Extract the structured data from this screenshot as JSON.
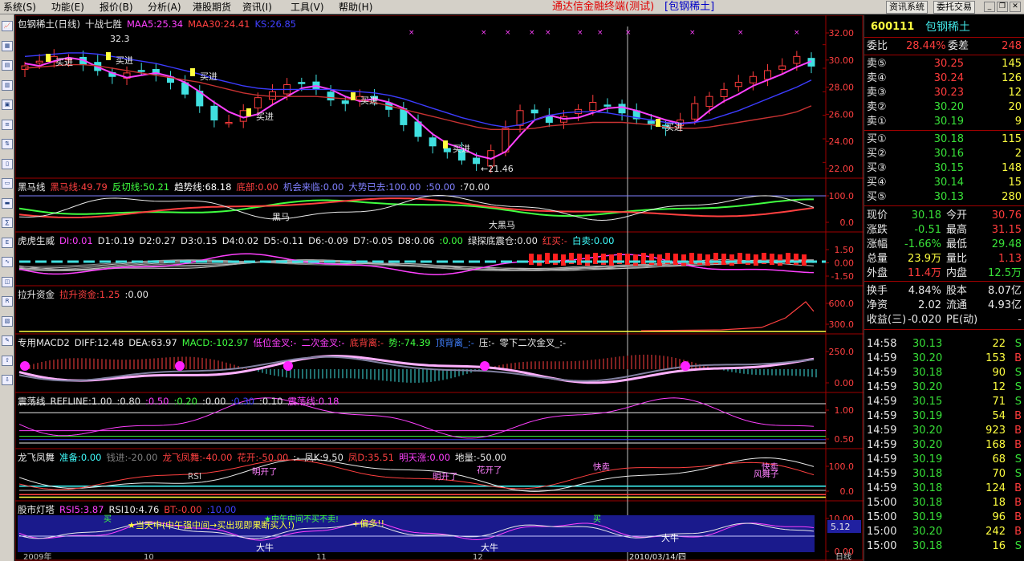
{
  "menu": {
    "items": [
      "系统(S)",
      "功能(E)",
      "报价(B)",
      "分析(A)",
      "港股期货",
      "资讯(I)",
      "工具(V)",
      "帮助(H)"
    ],
    "app_title": "通达信金融终端(测试)",
    "ticker_title": "[包钢稀土]",
    "btn_info": "资讯系统",
    "btn_trade": "委托交易"
  },
  "colors": {
    "up": "#ff3c3c",
    "down": "#38e038",
    "flat": "#e8e8e8",
    "accent": "#ffff40",
    "grid": "#a00000"
  },
  "toolbar_icons": [
    "chart-icon",
    "grid-icon",
    "table-icon",
    "bar-icon",
    "window-icon",
    "list-icon",
    "sort-icon",
    "doc-icon",
    "folder-icon",
    "news-icon",
    "calc-icon",
    "etf-icon",
    "wave-icon",
    "indicator-icon",
    "rsi-icon",
    "layout-icon",
    "edit-icon",
    "up-arrow-icon",
    "down-arrow-icon"
  ],
  "panes": [
    {
      "id": "main",
      "labels": [
        [
          "包钢稀土(日线)",
          "#e8e8e8"
        ],
        [
          "十战七胜",
          "#e8e8e8"
        ],
        [
          "MAA5:25.34",
          "#ff40ff"
        ],
        [
          "MAA30:24.41",
          "#ff4040"
        ],
        [
          "KS:26.85",
          "#4040ff"
        ]
      ],
      "axis": [
        "32.00",
        "30.00",
        "28.00",
        "26.00",
        "24.00",
        "22.00"
      ],
      "annotations": [
        "32.30",
        "买进",
        "买进",
        "买进",
        "买进",
        "买进",
        "买进",
        "买进",
        "←21.46"
      ]
    },
    {
      "id": "heima",
      "labels": [
        [
          "黑马线",
          "#e8e8e8"
        ],
        [
          "黑马线:49.79",
          "#ff4040"
        ],
        [
          "反切线:50.21",
          "#40ff40"
        ],
        [
          "趋势线:68.18",
          "#ffffff"
        ],
        [
          "底部:0.00",
          "#ff4040"
        ],
        [
          "机会来临:0.00",
          "#8080ff"
        ],
        [
          "大势已去:100.00",
          "#8080ff"
        ],
        [
          ":50.00",
          "#8080ff"
        ],
        [
          ":70.00",
          "#e8e8e8"
        ]
      ],
      "axis": [
        "100.0",
        "0.0"
      ],
      "annotations": [
        "黑马",
        "大黑马"
      ]
    },
    {
      "id": "huhu",
      "labels": [
        [
          "虎虎生威",
          "#e8e8e8"
        ],
        [
          "DI:0.01",
          "#ff40ff"
        ],
        [
          "D1:0.19",
          "#e8e8e8"
        ],
        [
          "D2:0.27",
          "#e8e8e8"
        ],
        [
          "D3:0.15",
          "#e8e8e8"
        ],
        [
          "D4:0.02",
          "#e8e8e8"
        ],
        [
          "D5:-0.11",
          "#e8e8e8"
        ],
        [
          "D6:-0.09",
          "#e8e8e8"
        ],
        [
          "D7:-0.05",
          "#e8e8e8"
        ],
        [
          "D8:0.06",
          "#e8e8e8"
        ],
        [
          ":0.00",
          "#40ff40"
        ],
        [
          "绿探底震仓:0.00",
          "#e8e8e8"
        ],
        [
          "红买:-",
          "#ff4040"
        ],
        [
          "白卖:0.00",
          "#40ffff"
        ]
      ],
      "axis": [
        "1.50",
        "0.00",
        "-1.50"
      ]
    },
    {
      "id": "lasheng",
      "labels": [
        [
          "拉升资金",
          "#e8e8e8"
        ],
        [
          "拉升资金:1.25",
          "#ff4040"
        ],
        [
          ":0.00",
          "#e8e8e8"
        ]
      ],
      "axis": [
        "600.0",
        "300.0"
      ]
    },
    {
      "id": "macd",
      "labels": [
        [
          "专用MACD2",
          "#e8e8e8"
        ],
        [
          "DIFF:12.48",
          "#e8e8e8"
        ],
        [
          "DEA:63.97",
          "#e8e8e8"
        ],
        [
          "MACD:-102.97",
          "#40ff40"
        ],
        [
          "低位金叉:-",
          "#ff40ff"
        ],
        [
          "二次金叉:-",
          "#ff40ff"
        ],
        [
          "底背离:-",
          "#ff4040"
        ],
        [
          "势:-74.39",
          "#40ff40"
        ],
        [
          "顶背离_:-",
          "#4080ff"
        ],
        [
          "压:-",
          "#e8e8e8"
        ],
        [
          "零下二次金叉_:-",
          "#e8e8e8"
        ]
      ],
      "axis": [
        "250.0",
        "0.00"
      ]
    },
    {
      "id": "zhendang",
      "labels": [
        [
          "震荡线",
          "#e8e8e8"
        ],
        [
          "REFLINE:1.00",
          "#e8e8e8"
        ],
        [
          ":0.80",
          "#e8e8e8"
        ],
        [
          ":0.50",
          "#ff40ff"
        ],
        [
          ":0.20",
          "#40ff40"
        ],
        [
          ":0.00",
          "#e8e8e8"
        ],
        [
          ":0.30",
          "#4040ff"
        ],
        [
          ":0.10",
          "#e8e8e8"
        ],
        [
          "震荡线:0.18",
          "#ff40ff"
        ]
      ],
      "axis": [
        "1.00",
        "0.50"
      ]
    },
    {
      "id": "longfei",
      "labels": [
        [
          "龙飞凤舞",
          "#e8e8e8"
        ],
        [
          "准备:0.00",
          "#40ffff"
        ],
        [
          "钱进:-20.00",
          "#808080"
        ],
        [
          "龙飞凤舞:-40.00",
          "#ff4040"
        ],
        [
          "花开:-50.00",
          "#ff4040"
        ],
        [
          ":-",
          "#e8e8e8"
        ],
        [
          "凤K:9.50",
          "#e8e8e8"
        ],
        [
          "凤D:35.51",
          "#ff4040"
        ],
        [
          "明天涨:0.00",
          "#ff40ff"
        ],
        [
          "地量:-50.00",
          "#e8e8e8"
        ]
      ],
      "axis": [
        "100.0",
        "0.0"
      ],
      "annotations": [
        "RSI",
        "明开了",
        "花开了",
        "明开了",
        "快卖",
        "快卖",
        "风舞子"
      ]
    },
    {
      "id": "dengta",
      "labels": [
        [
          "股市灯塔",
          "#e8e8e8"
        ],
        [
          "RSI5:3.87",
          "#ff40ff"
        ],
        [
          "RSI10:4.76",
          "#e8e8e8"
        ],
        [
          "BT:-0.00",
          "#ff4040"
        ],
        [
          ":10.00",
          "#4040ff"
        ]
      ],
      "axis": [
        "10.00",
        "0.00"
      ],
      "value_tag": "5.12",
      "annotations": [
        "★当天中(中午强中间→买出现即果断买入!)",
        "+偏多!!",
        "★中午中间不买不卖!",
        "买",
        "买",
        "大牛",
        "大牛",
        "大牛"
      ]
    }
  ],
  "date_axis": [
    "2009年",
    "10",
    "11",
    "12",
    "2010/03/14/四",
    "日线"
  ],
  "chart_data": {
    "type": "line",
    "title": "包钢稀土(日线)",
    "series": [
      {
        "name": "MAA5",
        "values": [
          30.4,
          30.2,
          30.6,
          30.9,
          30.7,
          30.1,
          29.6,
          29.2,
          29.4,
          29.6,
          29.3,
          28.8,
          28.0,
          27.1,
          26.3,
          25.8,
          26.1,
          26.9,
          27.6,
          28.3,
          28.5,
          28.2,
          27.6,
          27.2,
          27.4,
          27.1,
          26.6,
          25.5,
          24.4,
          23.6,
          23.2,
          22.6,
          22.3,
          22.9,
          24.3,
          25.6,
          26.0,
          25.7,
          25.8,
          26.2,
          26.6,
          26.7,
          26.4,
          26.0,
          25.6,
          25.3,
          25.4,
          26.4,
          27.2,
          27.8,
          28.5,
          29.0,
          29.5,
          30.1,
          30.6
        ]
      },
      {
        "name": "MAA30",
        "values": [
          30.0,
          30.1,
          30.2,
          30.3,
          30.3,
          30.2,
          30.0,
          29.8,
          29.6,
          29.4,
          29.2,
          29.0,
          28.8,
          28.5,
          28.2,
          27.9,
          27.7,
          27.6,
          27.6,
          27.6,
          27.6,
          27.5,
          27.4,
          27.3,
          27.1,
          26.8,
          26.5,
          26.2,
          25.9,
          25.6,
          25.3,
          25.0,
          24.8,
          24.8,
          24.8,
          24.9,
          25.1,
          25.2,
          25.3,
          25.4,
          25.4,
          25.4,
          25.3,
          25.2,
          25.0,
          24.9,
          24.9,
          25.0,
          25.2,
          25.4,
          25.6,
          25.8,
          26.0,
          26.3,
          26.8
        ]
      },
      {
        "name": "KS",
        "values": [
          31.0,
          31.1,
          31.2,
          31.3,
          31.3,
          31.2,
          31.0,
          30.8,
          30.6,
          30.4,
          30.1,
          29.8,
          29.5,
          29.1,
          28.8,
          28.5,
          28.3,
          28.2,
          28.2,
          28.2,
          28.2,
          28.2,
          28.1,
          28.0,
          27.9,
          27.7,
          27.4,
          27.0,
          26.6,
          26.2,
          25.8,
          25.5,
          25.2,
          25.0,
          25.2,
          25.6,
          26.0,
          26.2,
          26.3,
          26.3,
          26.2,
          26.0,
          25.8,
          25.6,
          25.4,
          25.3,
          25.4,
          25.6,
          26.0,
          26.4,
          26.9,
          27.4,
          27.9,
          28.4,
          29.0
        ]
      }
    ],
    "close": [
      30.2,
      30.6,
      31.0,
      30.8,
      30.3,
      29.8,
      29.3,
      29.6,
      29.8,
      29.5,
      28.8,
      27.8,
      26.8,
      25.6,
      25.4,
      26.4,
      27.5,
      28.0,
      28.6,
      28.7,
      28.2,
      27.3,
      27.0,
      27.6,
      27.3,
      26.5,
      25.2,
      24.2,
      23.4,
      22.9,
      22.2,
      21.9,
      23.0,
      24.9,
      26.4,
      26.2,
      25.4,
      25.9,
      26.5,
      27.1,
      26.8,
      26.2,
      25.7,
      25.3,
      24.9,
      25.6,
      27.0,
      27.6,
      28.2,
      28.8,
      29.3,
      29.8,
      30.2,
      31.0,
      30.18
    ],
    "ylim": [
      21,
      33
    ],
    "high_mark": 32.3,
    "low_mark": 21.46
  },
  "quote": {
    "code": "600111",
    "name": "包钢稀土",
    "weibi_label": "委比",
    "weibi": "28.44%",
    "weicha_label": "委差",
    "weicha": "248",
    "sell": [
      [
        "卖⑤",
        "30.25",
        "145",
        "red"
      ],
      [
        "卖④",
        "30.24",
        "126",
        "red"
      ],
      [
        "卖③",
        "30.23",
        "12",
        "red"
      ],
      [
        "卖②",
        "30.20",
        "20",
        "green"
      ],
      [
        "卖①",
        "30.19",
        "9",
        "green"
      ]
    ],
    "buy": [
      [
        "买①",
        "30.18",
        "115",
        "green"
      ],
      [
        "买②",
        "30.16",
        "2",
        "green"
      ],
      [
        "买③",
        "30.15",
        "148",
        "green"
      ],
      [
        "买④",
        "30.14",
        "15",
        "green"
      ],
      [
        "买⑤",
        "30.13",
        "280",
        "green"
      ]
    ],
    "stats": [
      [
        "现价",
        "30.18",
        "green",
        "今开",
        "30.76",
        "red"
      ],
      [
        "涨跌",
        "-0.51",
        "green",
        "最高",
        "31.15",
        "red"
      ],
      [
        "涨幅",
        "-1.66%",
        "green",
        "最低",
        "29.48",
        "green"
      ],
      [
        "总量",
        "23.9万",
        "yellow",
        "量比",
        "1.13",
        "red"
      ],
      [
        "外盘",
        "11.4万",
        "red",
        "内盘",
        "12.5万",
        "green"
      ]
    ],
    "stats2": [
      [
        "换手",
        "4.84%",
        "white",
        "股本",
        "8.07亿",
        "white"
      ],
      [
        "净资",
        "2.02",
        "white",
        "流通",
        "4.93亿",
        "white"
      ],
      [
        "收益(三)",
        "-0.020",
        "white",
        "PE(动)",
        "-",
        "white"
      ]
    ],
    "ticks": [
      [
        "14:58",
        "30.13",
        "green",
        "22",
        "S"
      ],
      [
        "14:59",
        "30.20",
        "green",
        "153",
        "B"
      ],
      [
        "14:59",
        "30.18",
        "green",
        "90",
        "S"
      ],
      [
        "14:59",
        "30.20",
        "green",
        "12",
        "S"
      ],
      [
        "14:59",
        "30.15",
        "green",
        "71",
        "S"
      ],
      [
        "14:59",
        "30.19",
        "green",
        "54",
        "B"
      ],
      [
        "14:59",
        "30.20",
        "green",
        "923",
        "B"
      ],
      [
        "14:59",
        "30.20",
        "green",
        "168",
        "B"
      ],
      [
        "14:59",
        "30.19",
        "green",
        "68",
        "S"
      ],
      [
        "14:59",
        "30.18",
        "green",
        "70",
        "S"
      ],
      [
        "14:59",
        "30.18",
        "green",
        "124",
        "B"
      ],
      [
        "15:00",
        "30.18",
        "green",
        "18",
        "B"
      ],
      [
        "15:00",
        "30.19",
        "green",
        "96",
        "B"
      ],
      [
        "15:00",
        "30.20",
        "green",
        "242",
        "B"
      ],
      [
        "15:00",
        "30.18",
        "green",
        "16",
        "S"
      ]
    ]
  }
}
